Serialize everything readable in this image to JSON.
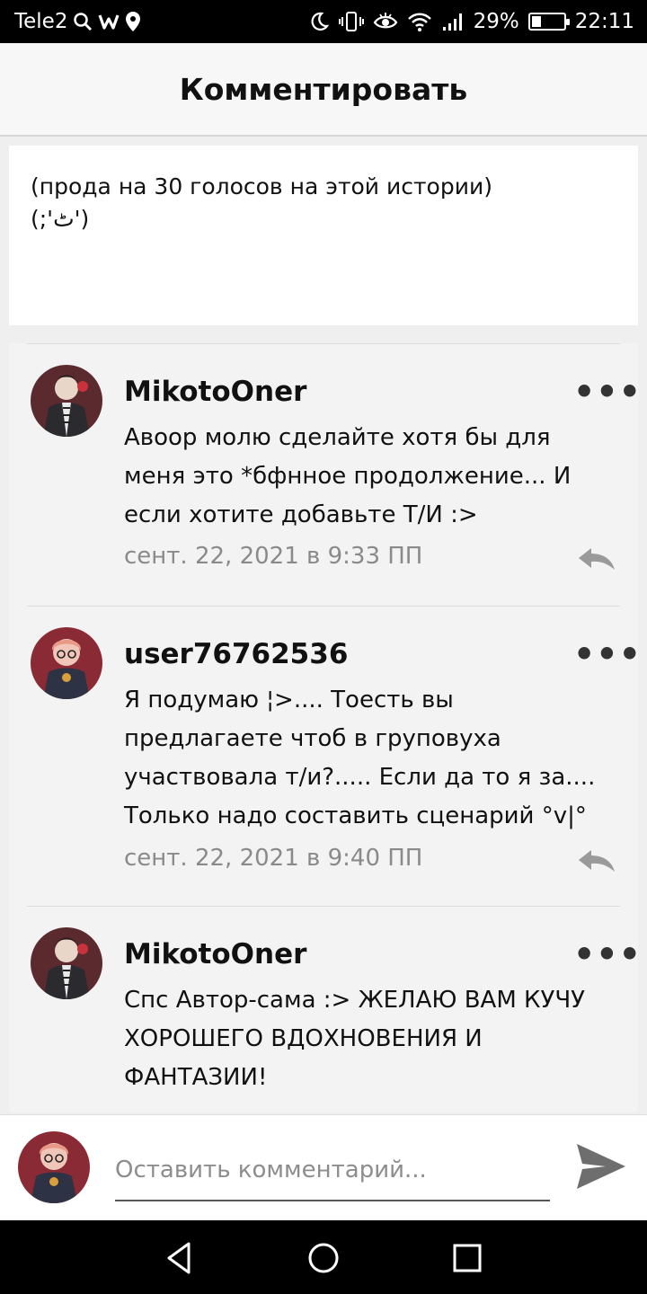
{
  "status_bar": {
    "carrier": "Tele2",
    "battery_percent": "29%",
    "battery_level": 0.29,
    "time": "22:11",
    "icons": [
      "search-icon",
      "w-app-icon",
      "location-icon",
      "moon-icon",
      "vibrate-icon",
      "eye-icon",
      "wifi-icon",
      "signal-icon",
      "battery-icon"
    ]
  },
  "header": {
    "title": "Комментировать"
  },
  "story": {
    "text": "(прода на 30 голосов на этой истории)\n(;'ٹ')"
  },
  "comments": [
    {
      "user": "MikotoOner",
      "text": "Авоор молю сделайте хотя бы для меня это *бфнное продолжение... И если хотите добавьте Т/И :>",
      "date": "сент. 22, 2021 в 9:33 ПП",
      "more": "•••"
    },
    {
      "user": "user76762536",
      "text": "Я подумаю ¦>.... Тоесть вы предлагаете чтоб в груповуха участвовала т/и?..... Если да то я за.... Только надо составить сценарий °v|°",
      "date": "сент. 22, 2021 в 9:40 ПП",
      "more": "•••"
    },
    {
      "user": "MikotoOner",
      "text": "Спс Автор-сама :> ЖЕЛАЮ ВАМ КУЧУ ХОРОШЕГО ВДОХНОВЕНИЯ И ФАНТАЗИИ!",
      "date": "",
      "more": "•••"
    }
  ],
  "input": {
    "placeholder": "Оставить комментарий...",
    "value": ""
  },
  "colors": {
    "header_bg": "#f7f7f7",
    "list_bg": "#f3f3f4",
    "date_gray": "#8a8a8a",
    "send_gray": "#6e6e6e"
  }
}
